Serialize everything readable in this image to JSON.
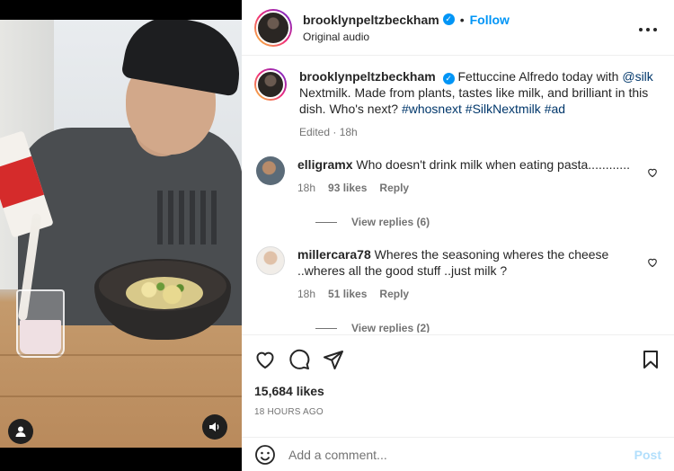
{
  "author": {
    "username": "brooklynpeltzbeckham",
    "verified_icon": "verified-badge-icon",
    "follow_label": "Follow",
    "separator": "•",
    "audio": "Original audio"
  },
  "caption": {
    "username": "brooklynpeltzbeckham",
    "text_start": "Fettuccine Alfredo today with ",
    "mention": "@silk",
    "text_middle": " Nextmilk. Made from plants, tastes like milk, and brilliant in this dish. Who's next? ",
    "hashtags": [
      "#whosnext",
      "#SilkNextmilk",
      "#ad"
    ],
    "edited": "Edited · 18h"
  },
  "comments": [
    {
      "username": "elligramx",
      "text": "Who doesn't drink milk when eating pasta............",
      "age": "18h",
      "likes": "93 likes",
      "reply_label": "Reply",
      "view_replies": "View replies (6)"
    },
    {
      "username": "millercara78",
      "text": "Wheres the seasoning wheres the cheese ..wheres all the good stuff ..just milk ?",
      "age": "18h",
      "likes": "51 likes",
      "reply_label": "Reply",
      "view_replies": "View replies (2)"
    }
  ],
  "actions": {
    "likes": "15,684 likes",
    "date": "18 HOURS AGO",
    "icons": [
      "heart-icon",
      "comment-icon",
      "share-icon",
      "bookmark-icon"
    ]
  },
  "composer": {
    "placeholder": "Add a comment...",
    "post_label": "Post",
    "post_color": "#b2dffc"
  },
  "colors": {
    "link": "#0095f6",
    "hashtag": "#00376b",
    "muted": "#737373"
  }
}
